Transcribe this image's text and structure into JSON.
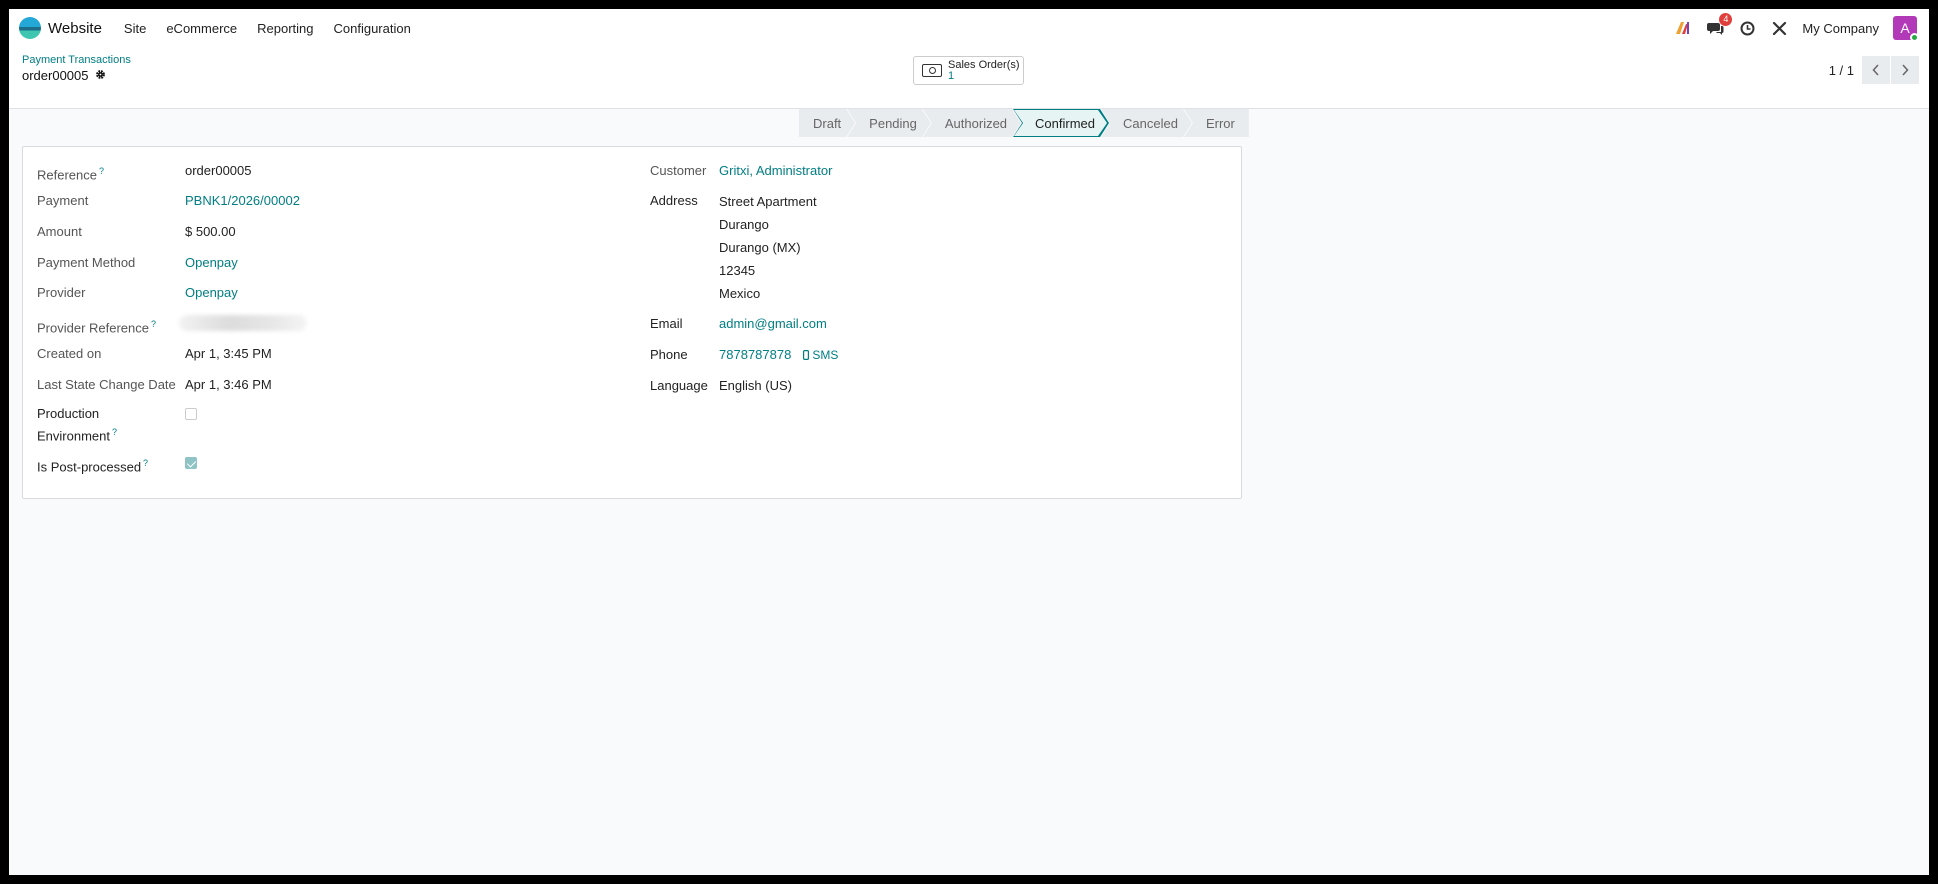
{
  "navbar": {
    "app_name": "Website",
    "menu": [
      "Site",
      "eCommerce",
      "Reporting",
      "Configuration"
    ],
    "messages_badge": "4",
    "company": "My Company",
    "avatar_letter": "A"
  },
  "control_panel": {
    "breadcrumb": "Payment Transactions",
    "record_name": "order00005",
    "smart_button": {
      "label": "Sales Order(s)",
      "count": "1"
    },
    "pager": {
      "value": "1 / 1"
    }
  },
  "statusbar": {
    "stages": [
      "Draft",
      "Pending",
      "Authorized",
      "Confirmed",
      "Canceled",
      "Error"
    ],
    "active": "Confirmed"
  },
  "form": {
    "left": {
      "reference_label": "Reference",
      "reference_value": "order00005",
      "payment_label": "Payment",
      "payment_value": "PBNK1/2026/00002",
      "amount_label": "Amount",
      "amount_value": "$ 500.00",
      "payment_method_label": "Payment Method",
      "payment_method_value": "Openpay",
      "provider_label": "Provider",
      "provider_value": "Openpay",
      "provider_reference_label": "Provider Reference",
      "created_on_label": "Created on",
      "created_on_value": "Apr 1, 3:45 PM",
      "last_state_label": "Last State Change Date",
      "last_state_value": "Apr 1, 3:46 PM",
      "production_env_label_1": "Production",
      "production_env_label_2": "Environment",
      "production_env_checked": false,
      "post_processed_label": "Is Post-processed",
      "post_processed_checked": true
    },
    "right": {
      "customer_label": "Customer",
      "customer_value": "Gritxi, Administrator",
      "address_label": "Address",
      "address_lines": [
        "Street Apartment",
        "Durango",
        "Durango (MX)",
        "12345",
        "Mexico"
      ],
      "email_label": "Email",
      "email_value": "admin@gmail.com",
      "phone_label": "Phone",
      "phone_value": "7878787878",
      "sms_label": "SMS",
      "language_label": "Language",
      "language_value": "English (US)"
    },
    "help_mark": "?"
  },
  "colors": {
    "accent": "#017e84",
    "badge": "#e0403b",
    "avatar": "#b23ab8"
  }
}
